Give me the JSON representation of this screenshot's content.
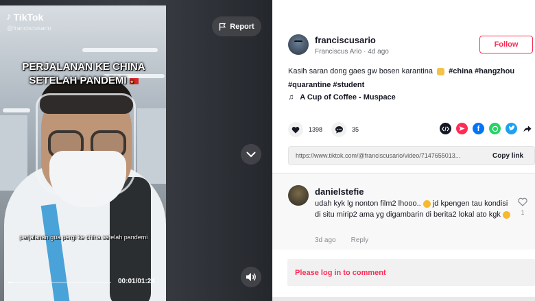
{
  "video": {
    "brand": "TikTok",
    "handle": "@franciscusario",
    "overlay_title_line1": "PERJALANAN KE CHINA",
    "overlay_title_line2": "SETELAH PANDEMI",
    "subtitle": "perjalanan gua pergi ke china setelah pandemi",
    "time": "00:01/01:24",
    "progress": 0.03,
    "report_label": "Report"
  },
  "author": {
    "username": "franciscusario",
    "display_name": "Franciscus Ario",
    "posted": "4d ago",
    "follow_label": "Follow"
  },
  "description": {
    "text": "Kasih saran dong gaes gw bosen karantina",
    "tags": [
      "#china",
      "#hangzhou",
      "#quarantine",
      "#student"
    ]
  },
  "music": "A Cup of Coffee - Muspace",
  "stats": {
    "likes": "1398",
    "comments": "35"
  },
  "share": {
    "icons": [
      "embed-icon",
      "send-icon",
      "facebook-icon",
      "whatsapp-icon",
      "twitter-icon",
      "share-arrow-icon"
    ],
    "colors": {
      "embed": "#161823",
      "send": "#fe2c55",
      "facebook": "#0075fa",
      "whatsapp": "#25d366",
      "twitter": "#1da1f2"
    }
  },
  "link": {
    "url": "https://www.tiktok.com/@franciscusario/video/7147655013...",
    "copy_label": "Copy link"
  },
  "comment": {
    "username": "danielstefie",
    "text_part1": "udah kyk lg nonton film2 lhooo..",
    "text_part2": "jd kpengen tau kondisi di situ mirip2 ama yg digambarin di berita2 lokal ato kgk",
    "age": "3d ago",
    "reply_label": "Reply",
    "likes": "1"
  },
  "login_prompt": "Please log in to comment",
  "accent": "#fe2c55"
}
